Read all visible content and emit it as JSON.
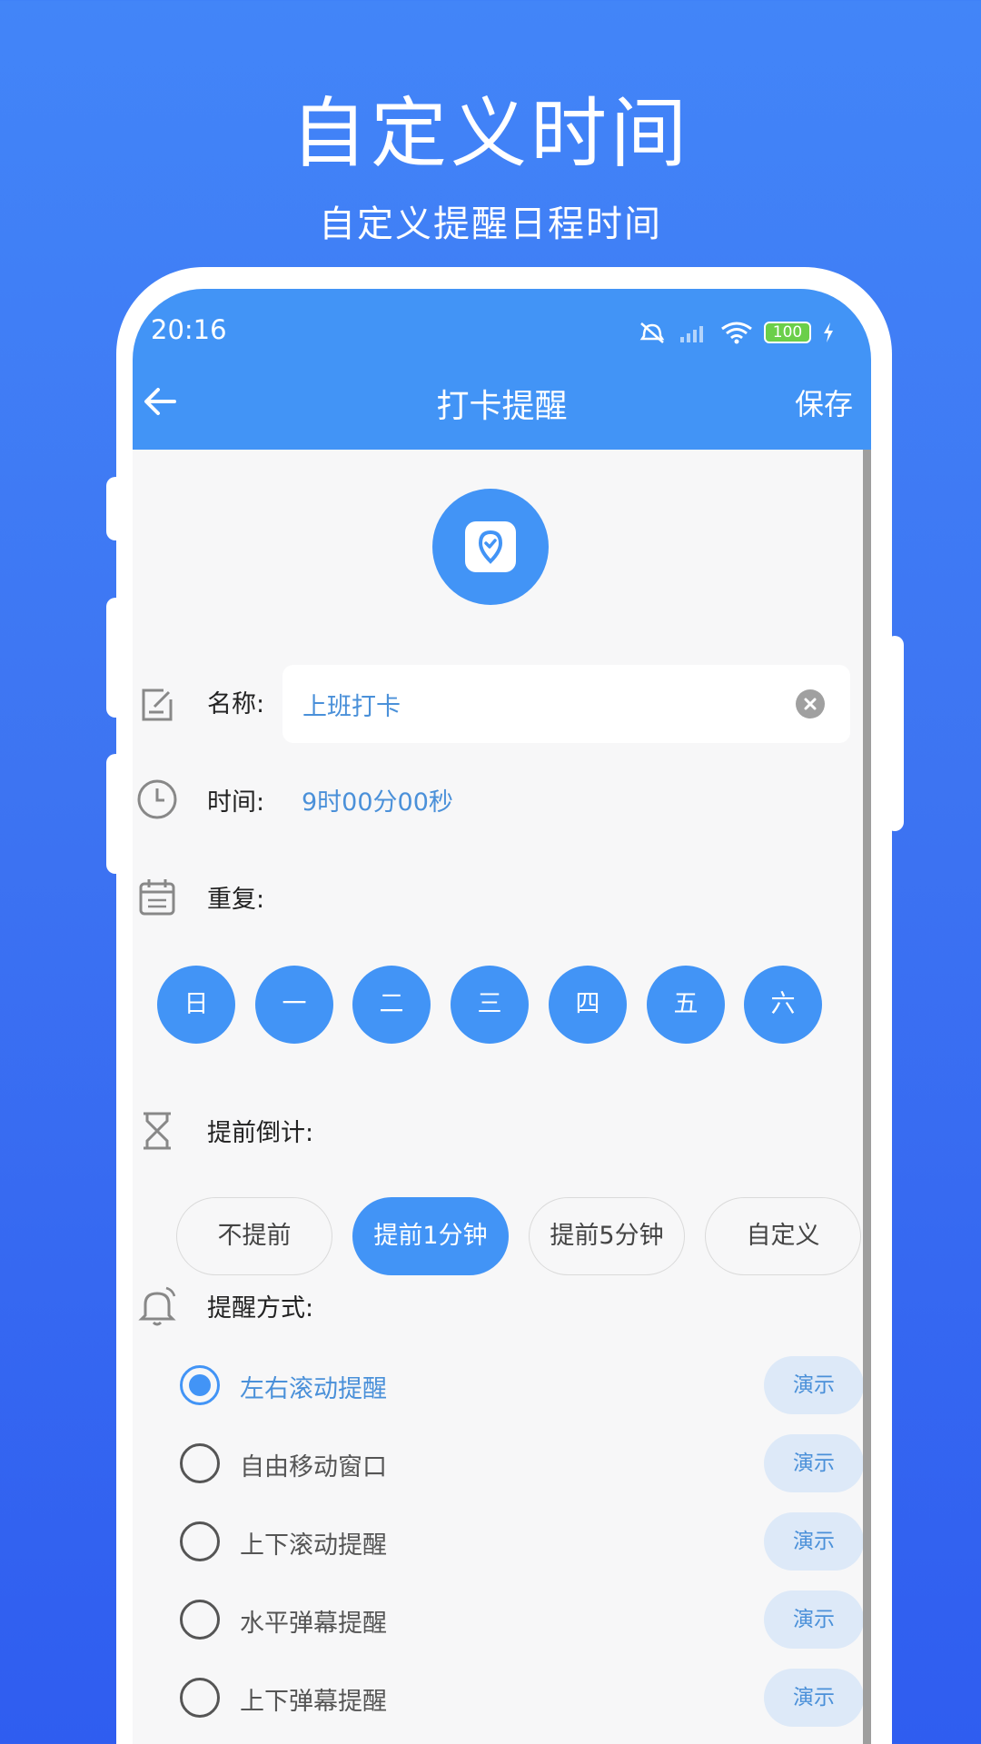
{
  "promo": {
    "title": "自定义时间",
    "subtitle": "自定义提醒日程时间"
  },
  "status_bar": {
    "time": "20:16",
    "battery": "100"
  },
  "app_bar": {
    "title": "打卡提醒",
    "save_label": "保存"
  },
  "form": {
    "name_label": "名称:",
    "name_value": "上班打卡",
    "time_label": "时间:",
    "time_value": "9时00分00秒",
    "repeat_label": "重复:",
    "days": [
      "日",
      "一",
      "二",
      "三",
      "四",
      "五",
      "六"
    ],
    "countdown_label": "提前倒计:",
    "countdown_options": [
      "不提前",
      "提前1分钟",
      "提前5分钟",
      "自定义"
    ],
    "countdown_selected": "提前1分钟",
    "method_label": "提醒方式:",
    "methods": [
      {
        "label": "左右滚动提醒",
        "checked": true,
        "demo": "演示"
      },
      {
        "label": "自由移动窗口",
        "checked": false,
        "demo": "演示"
      },
      {
        "label": "上下滚动提醒",
        "checked": false,
        "demo": "演示"
      },
      {
        "label": "水平弹幕提醒",
        "checked": false,
        "demo": "演示"
      },
      {
        "label": "上下弹幕提醒",
        "checked": false,
        "demo": "演示"
      }
    ]
  },
  "colors": {
    "accent": "#4294f6",
    "background_top": "#4285f8",
    "background_bottom": "#2f5df0",
    "link_text": "#4a90d9"
  }
}
